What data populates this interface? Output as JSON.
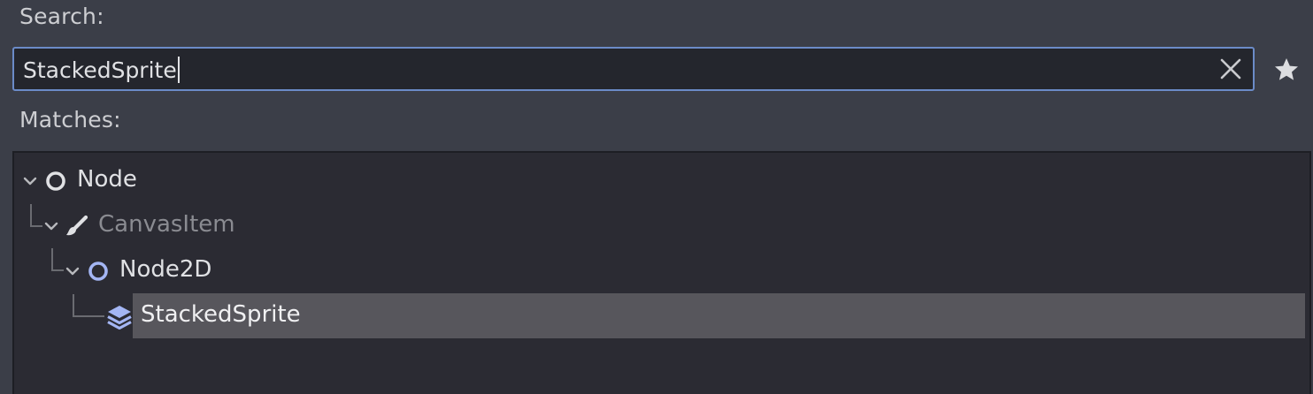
{
  "search": {
    "label": "Search:",
    "value": "StackedSprite",
    "clear_icon": "close-icon",
    "favorite_icon": "star-icon"
  },
  "matches": {
    "label": "Matches:",
    "items": [
      {
        "label": "Node",
        "icon": "circle-node-icon",
        "expanded": true,
        "dim": false
      },
      {
        "label": "CanvasItem",
        "icon": "brush-icon",
        "expanded": true,
        "dim": true
      },
      {
        "label": "Node2D",
        "icon": "circle-node2d-icon",
        "expanded": true,
        "dim": false
      },
      {
        "label": "StackedSprite",
        "icon": "layers-icon",
        "selected": true,
        "dim": false
      }
    ]
  },
  "colors": {
    "accent": "#6b8bc8",
    "node2d_icon": "#a4b6f4",
    "selected_row": "#57565c"
  }
}
